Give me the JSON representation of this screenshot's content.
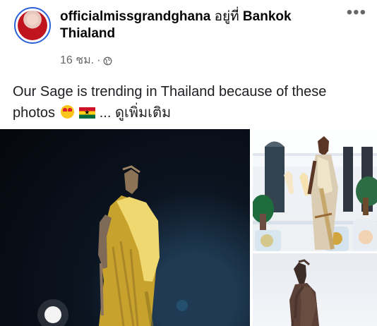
{
  "post": {
    "author": "officialmissgrandghana",
    "location_prefix": "อยู่ที่",
    "location": "Bankok Thialand",
    "timestamp": "16 ชม.",
    "privacy_icon": "globe-icon",
    "text_part1": "Our Sage is trending in Thailand because of these photos",
    "emoji": [
      "heart-eyes-emoji",
      "ghana-flag-emoji"
    ],
    "see_more": "... ดูเพิ่มเติม"
  },
  "photos": {
    "main": "statue-night",
    "top_right": "model-in-thai-dress",
    "bottom_right": "statue-day"
  },
  "colors": {
    "accent": "#2a63d8",
    "meta_text": "#65676b",
    "text": "#1c1e21"
  }
}
